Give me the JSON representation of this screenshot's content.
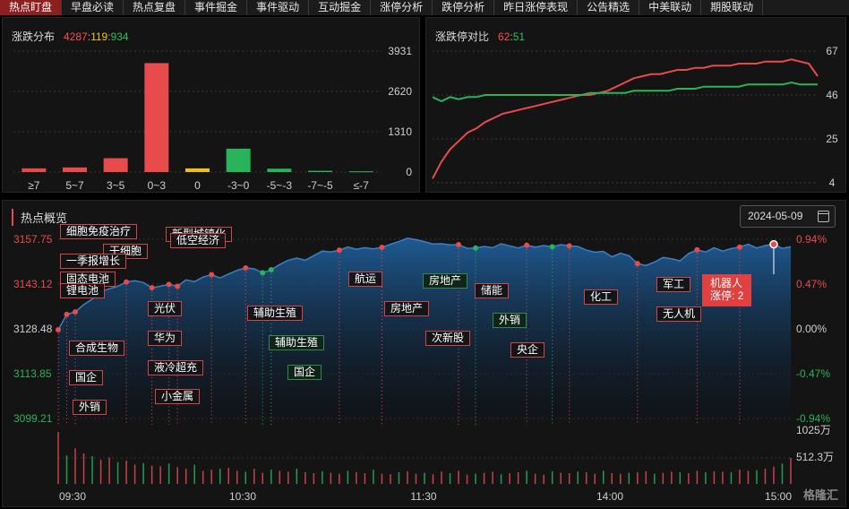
{
  "nav": {
    "tabs": [
      "热点盯盘",
      "早盘必读",
      "热点复盘",
      "事件掘金",
      "事件驱动",
      "互动掘金",
      "涨停分析",
      "跌停分析",
      "昨日涨停表现",
      "公告精选",
      "中美联动",
      "期股联动"
    ],
    "active_index": 0
  },
  "dist_panel": {
    "title": "涨跌分布",
    "up": "4287",
    "flat": "119",
    "down": "934",
    "sep": ":"
  },
  "ratio_panel": {
    "title": "涨跌停对比",
    "limit_up": "62",
    "limit_down": "51",
    "sep": ":"
  },
  "hot_panel": {
    "title": "热点概览",
    "date": "2024-05-09",
    "watermark": "格隆汇"
  },
  "tags": [
    "细胞免疫治疗",
    "干细胞",
    "一季报增长",
    "固态电池",
    "锂电池",
    "合成生物",
    "国企",
    "外销",
    "新型城镇化",
    "低空经济",
    "光伏",
    "华为",
    "液冷超充",
    "小金属",
    "辅助生殖",
    "辅助生殖",
    "国企",
    "航运",
    "房地产",
    "房地产",
    "次新股",
    "储能",
    "外销",
    "央企",
    "化工",
    "军工",
    "无人机",
    "机器人",
    "涨停: 2"
  ],
  "colors": {
    "up": "#e84b4b",
    "down": "#29b35a",
    "flat": "#f2c012"
  },
  "chart_data": [
    {
      "type": "bar",
      "title": "涨跌分布",
      "categories": [
        "≥7",
        "5~7",
        "3~5",
        "0~3",
        "0",
        "-3~0",
        "-5~-3",
        "-7~-5",
        "≤-7"
      ],
      "values": [
        120,
        150,
        450,
        3540,
        119,
        760,
        110,
        40,
        24
      ],
      "y_ticks": [
        "3931",
        "2620",
        "1310",
        "0"
      ],
      "ylim": [
        0,
        3931
      ],
      "colors": [
        "#e84b4b",
        "#e84b4b",
        "#e84b4b",
        "#e84b4b",
        "#f2c012",
        "#29b35a",
        "#29b35a",
        "#29b35a",
        "#29b35a"
      ]
    },
    {
      "type": "line",
      "title": "涨跌停对比",
      "y_ticks": [
        "67",
        "46",
        "25",
        "4"
      ],
      "ylim": [
        4,
        67
      ],
      "series": [
        {
          "name": "涨停",
          "color": "#e84b4b",
          "values": [
            6,
            14,
            20,
            24,
            28,
            30,
            33,
            35,
            37,
            38,
            39,
            40,
            41,
            42,
            43,
            44,
            45,
            46,
            46,
            47,
            48,
            50,
            52,
            54,
            55,
            56,
            56,
            57,
            58,
            58,
            59,
            59,
            60,
            60,
            60,
            61,
            61,
            61,
            62,
            62,
            62,
            63,
            62,
            61,
            55
          ]
        },
        {
          "name": "跌停",
          "color": "#29b35a",
          "values": [
            45,
            43,
            45,
            44,
            45,
            45,
            46,
            46,
            46,
            46,
            46,
            46,
            46,
            46,
            46,
            46,
            46,
            46,
            47,
            47,
            47,
            47,
            47,
            48,
            48,
            48,
            48,
            48,
            49,
            49,
            49,
            50,
            50,
            50,
            50,
            50,
            51,
            51,
            51,
            51,
            51,
            52,
            51,
            51,
            51
          ]
        }
      ]
    },
    {
      "type": "area",
      "title": "热点概览",
      "y_ticks_left": [
        "3157.75",
        "3143.12",
        "3128.48",
        "3113.85",
        "3099.21"
      ],
      "y_ticks_right": [
        "0.94%",
        "0.47%",
        "0.00%",
        "-0.47%",
        "-0.94%"
      ],
      "volume_ticks": [
        "1025万",
        "512.3万"
      ],
      "x_ticks": [
        "09:30",
        "10:30",
        "11:30",
        "14:00",
        "15:00"
      ],
      "ylim": [
        3099.21,
        3157.75
      ],
      "prices": [
        3128.2,
        3133.2,
        3134.0,
        3136.4,
        3138.2,
        3140.6,
        3141.6,
        3142.4,
        3143.8,
        3144.2,
        3143.6,
        3141.9,
        3142.4,
        3143.0,
        3142.4,
        3144.5,
        3143.9,
        3145.4,
        3146.2,
        3145.1,
        3146.4,
        3147.6,
        3148.4,
        3148.1,
        3146.8,
        3147.8,
        3149.5,
        3150.9,
        3151.6,
        3150.9,
        3152.4,
        3153.9,
        3153.6,
        3154.2,
        3155.2,
        3154.5,
        3155.0,
        3154.6,
        3155.1,
        3156.1,
        3157.0,
        3158.1,
        3157.6,
        3157.0,
        3156.2,
        3156.3,
        3155.9,
        3156.0,
        3154.8,
        3154.9,
        3155.4,
        3155.0,
        3156.3,
        3155.6,
        3154.9,
        3155.8,
        3155.2,
        3155.7,
        3155.3,
        3156.0,
        3155.6,
        3155.4,
        3154.2,
        3153.5,
        3153.8,
        3152.0,
        3153.2,
        3152.4,
        3149.8,
        3149.2,
        3150.3,
        3151.8,
        3151.4,
        3150.7,
        3153.1,
        3154.3,
        3153.6,
        3155.0,
        3153.9,
        3154.7,
        3155.2,
        3156.1,
        3154.9,
        3155.7,
        3156.1,
        3154.8,
        3155.3
      ],
      "volume": [
        1025,
        560,
        700,
        600,
        550,
        480,
        520,
        430,
        460,
        380,
        410,
        360,
        350,
        400,
        330,
        300,
        380,
        260,
        280,
        300,
        320,
        260,
        240,
        300,
        220,
        280,
        260,
        240,
        300,
        230,
        210,
        250,
        220,
        200,
        260,
        230,
        210,
        280,
        200,
        190,
        230,
        250,
        200,
        220,
        190,
        240,
        210,
        260,
        180,
        200,
        220,
        240,
        190,
        210,
        230,
        260,
        200,
        180,
        250,
        220,
        210,
        240,
        230,
        200,
        260,
        210,
        200,
        220,
        230,
        250,
        200,
        220,
        240,
        230,
        210,
        260,
        230,
        250,
        240,
        230,
        280,
        260,
        270,
        300,
        340,
        400,
        512
      ]
    }
  ]
}
